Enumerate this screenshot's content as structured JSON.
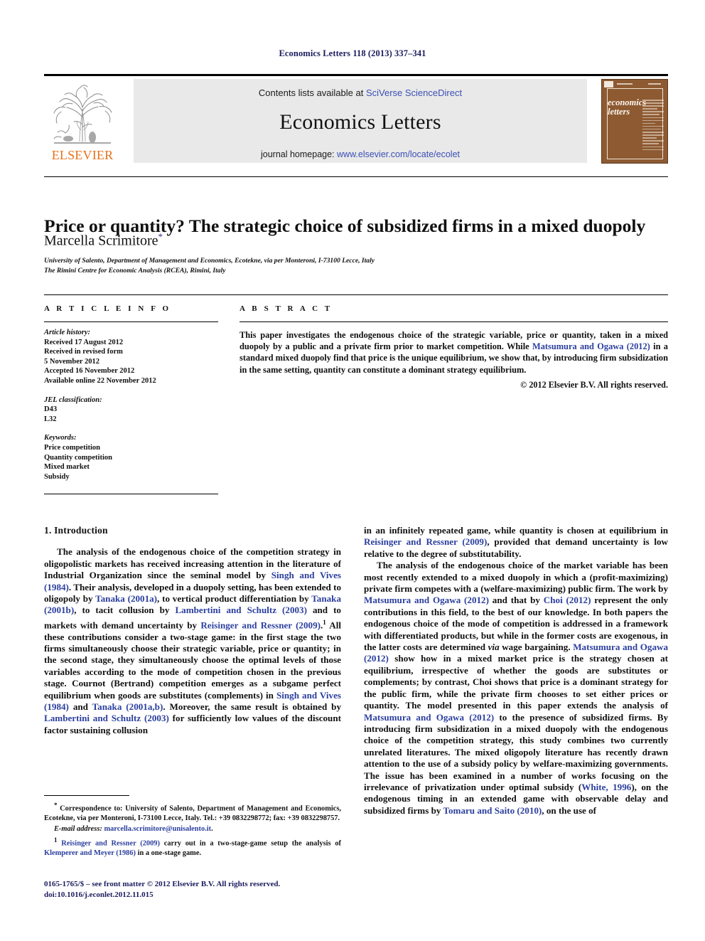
{
  "running_head": "Economics Letters 118 (2013) 337–341",
  "masthead": {
    "contents_prefix": "Contents lists available at ",
    "sciencedirect_link": "SciVerse ScienceDirect",
    "journal_title": "Economics Letters",
    "homepage_prefix": "journal homepage: ",
    "homepage_link": "www.elsevier.com/locate/ecolet",
    "publisher_wordmark": "ELSEVIER",
    "cover_title_line1": "economics",
    "cover_title_line2": "letters"
  },
  "article": {
    "title": "Price or quantity? The strategic choice of subsidized firms in a mixed duopoly",
    "author": "Marcella Scrimitore",
    "author_marker": "*",
    "affiliation_1": "University of Salento, Department of Management and Economics, Ecotekne, via per Monteroni, I-73100 Lecce, Italy",
    "affiliation_2": "The Rimini Centre for Economic Analysis (RCEA), Rimini, Italy"
  },
  "article_info": {
    "heading": "A R T I C L E   I N F O",
    "history_label": "Article history:",
    "history": [
      "Received 17 August 2012",
      "Received in revised form",
      "5 November 2012",
      "Accepted 16 November 2012",
      "Available online 22 November 2012"
    ],
    "jel_label": "JEL classification:",
    "jel_codes": [
      "D43",
      "L32"
    ],
    "keywords_label": "Keywords:",
    "keywords": [
      "Price competition",
      "Quantity competition",
      "Mixed market",
      "Subsidy"
    ]
  },
  "abstract": {
    "heading": "A B S T R A C T",
    "text_part1": "This paper investigates the endogenous choice of the strategic variable, price or quantity, taken in a mixed duopoly by a public and a private firm prior to market competition. While ",
    "citation": "Matsumura and Ogawa (2012)",
    "text_part2": " in a standard mixed duopoly find that price is the unique equilibrium, we show that, by introducing firm subsidization in the same setting, quantity can constitute a dominant strategy equilibrium.",
    "copyright": "© 2012 Elsevier B.V. All rights reserved."
  },
  "body": {
    "section_heading": "1. Introduction",
    "left_p1_a": "The analysis of the endogenous choice of the competition strategy in oligopolistic markets has received increasing attention in the literature of Industrial Organization since the seminal model by ",
    "left_cit1": "Singh and Vives (1984)",
    "left_p1_b": ". Their analysis, developed in a duopoly setting, has been extended to oligopoly by ",
    "left_cit2": "Tanaka (2001a)",
    "left_p1_c": ", to vertical product differentiation by ",
    "left_cit3": "Tanaka (2001b)",
    "left_p1_d": ", to tacit collusion by ",
    "left_cit4": "Lambertini and Schultz (2003)",
    "left_p1_e": " and to markets with demand uncertainty by ",
    "left_cit5": "Reisinger and Ressner (2009)",
    "left_p1_f": ".",
    "left_fn_marker": "1",
    "left_p1_g": " All these contributions consider a two-stage game: in the first stage the two firms simultaneously choose their strategic variable, price or quantity; in the second stage, they simultaneously choose the optimal levels of those variables according to the mode of competition chosen in the previous stage. Cournot (Bertrand) competition emerges as a subgame perfect equilibrium when goods are substitutes (complements) in ",
    "left_cit6": "Singh and Vives (1984)",
    "left_p1_h": " and ",
    "left_cit7": "Tanaka (2001a,b)",
    "left_p1_i": ". Moreover, the same result is obtained by ",
    "left_cit8": "Lambertini and Schultz (2003)",
    "left_p1_j": " for sufficiently low values of the discount factor sustaining collusion",
    "right_p1_a": "in an infinitely repeated game, while quantity is chosen at equilibrium in ",
    "right_cit1": "Reisinger and Ressner (2009)",
    "right_p1_b": ", provided that demand uncertainty is low relative to the degree of substitutability.",
    "right_p2_a": "The analysis of the endogenous choice of the market variable has been most recently extended to a mixed duopoly in which a (profit-maximizing) private firm competes with a (welfare-maximizing) public firm. The work by ",
    "right_cit2": "Matsumura and Ogawa (2012)",
    "right_p2_b": " and that by ",
    "right_cit3": "Choi (2012)",
    "right_p2_c": " represent the only contributions in this field, to the best of our knowledge. In both papers the endogenous choice of the mode of competition is addressed in a framework with differentiated products, but while in the former costs are exogenous, in the latter costs are determined ",
    "right_italic1": "via",
    "right_p2_d": " wage bargaining. ",
    "right_cit4": "Matsumura and Ogawa (2012)",
    "right_p2_e": " show how in a mixed market price is the strategy chosen at equilibrium, irrespective of whether the goods are substitutes or complements; by contrast, Choi shows that price is a dominant strategy for the public firm, while the private firm chooses to set either prices or quantity. The model presented in this paper extends the analysis of ",
    "right_cit5": "Matsumura and Ogawa (2012)",
    "right_p2_f": " to the presence of subsidized firms. By introducing firm subsidization in a mixed duopoly with the endogenous choice of the competition strategy, this study combines two currently unrelated literatures. The mixed oligopoly literature has recently drawn attention to the use of a subsidy policy by welfare-maximizing governments. The issue has been examined in a number of works focusing on the irrelevance of privatization under optimal subsidy (",
    "right_cit6": "White, 1996",
    "right_p2_g": "), on the endogenous timing in an extended game with observable delay and subsidized firms by ",
    "right_cit7": "Tomaru and Saito (2010)",
    "right_p2_h": ", on the use of"
  },
  "footnotes": {
    "corr_marker": "*",
    "corr_text": " Correspondence to: University of Salento, Department of Management and Economics, Ecotekne, via per Monteroni, I-73100 Lecce, Italy. Tel.: +39 0832298772; fax: +39 0832298757.",
    "email_label": "E-mail address:",
    "email": "marcella.scrimitore@unisalento.it",
    "email_suffix": ".",
    "fn1_marker": "1",
    "fn1_cit1": "Reisinger and Ressner (2009)",
    "fn1_text_a": " carry out in a two-stage-game setup the analysis of ",
    "fn1_cit2": "Klemperer and Meyer (1986)",
    "fn1_text_b": " in a one-stage game."
  },
  "imprint": {
    "issn_line": "0165-1765/$ – see front matter © 2012 Elsevier B.V. All rights reserved.",
    "doi_line": "doi:10.1016/j.econlet.2012.11.015"
  },
  "colors": {
    "link_blue": "#2b3f9e",
    "sd_blue": "#3a4fb5",
    "elsevier_orange": "#e8701a",
    "cover_brown": "#8d5a32",
    "running_head": "#1b1b5e"
  }
}
